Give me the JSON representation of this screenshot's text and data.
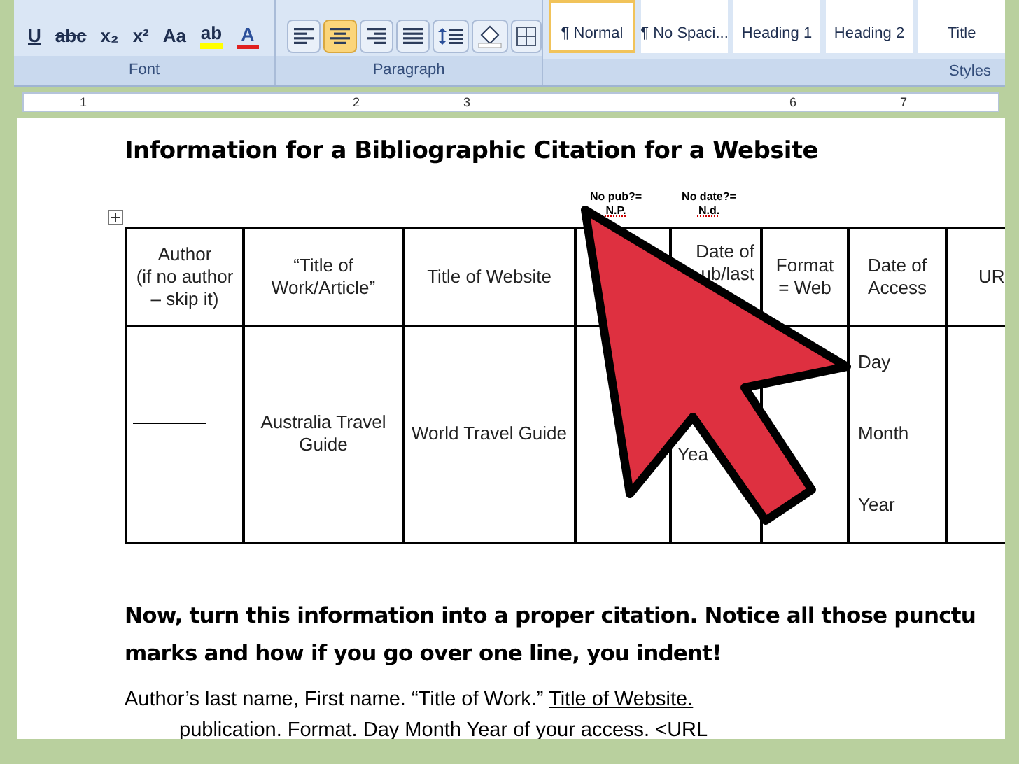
{
  "ribbon": {
    "font": {
      "label": "Font",
      "buttons": [
        {
          "kind": "underline",
          "text": "U"
        },
        {
          "kind": "strike",
          "text": "abc"
        },
        {
          "kind": "plain",
          "text": "x₂"
        },
        {
          "kind": "plain",
          "text": "x²"
        },
        {
          "kind": "plain",
          "text": "Aa"
        },
        {
          "kind": "highlight",
          "text": "ab"
        },
        {
          "kind": "font-color",
          "text": "A"
        }
      ]
    },
    "paragraph": {
      "label": "Paragraph",
      "buttons": [
        {
          "kind": "align-left",
          "selected": false
        },
        {
          "kind": "align-center",
          "selected": true
        },
        {
          "kind": "align-right",
          "selected": false
        },
        {
          "kind": "justify",
          "selected": false
        },
        {
          "kind": "line-spacing",
          "selected": false
        },
        {
          "kind": "shading",
          "selected": false
        },
        {
          "kind": "borders",
          "selected": false
        }
      ]
    },
    "styles": {
      "label": "Styles",
      "items": [
        {
          "label": "¶ Normal",
          "selected": true
        },
        {
          "label": "¶ No Spaci...",
          "selected": false
        },
        {
          "label": "Heading 1",
          "selected": false
        },
        {
          "label": "Heading 2",
          "selected": false
        },
        {
          "label": "Title",
          "selected": false
        }
      ]
    }
  },
  "ruler": {
    "numbers": [
      "1",
      "2",
      "3",
      "6",
      "7"
    ]
  },
  "document": {
    "heading": "Information for a Bibliographic Citation for a Website",
    "notes": [
      {
        "line1": "No pub?=",
        "line2": "N.P."
      },
      {
        "line1": "No date?=",
        "line2": "N.d."
      }
    ],
    "table": {
      "columns": [
        "Author\n(if no author\n– skip it)",
        "“Title of\nWork/Article”",
        "Title of Website",
        "",
        "Date of\nub/last",
        "Format\n= Web",
        "Date of\nAccess",
        "UR"
      ],
      "row": {
        "title_of_work": "Australia Travel Guide",
        "title_of_website": "World Travel Guide",
        "date_of_pub": "Yea",
        "date_of_access": [
          "Day",
          "Month",
          "Year"
        ]
      }
    },
    "instruction": "Now, turn this information into a proper citation. Notice all those punctu\nmarks and how if you go over one line, you indent!",
    "citation": {
      "part1": "Author’s last name, First name. “Title of Work.” ",
      "website": "Title of Website.",
      "line2": "publication. Format. Day Month Year of your access. <URL"
    }
  }
}
